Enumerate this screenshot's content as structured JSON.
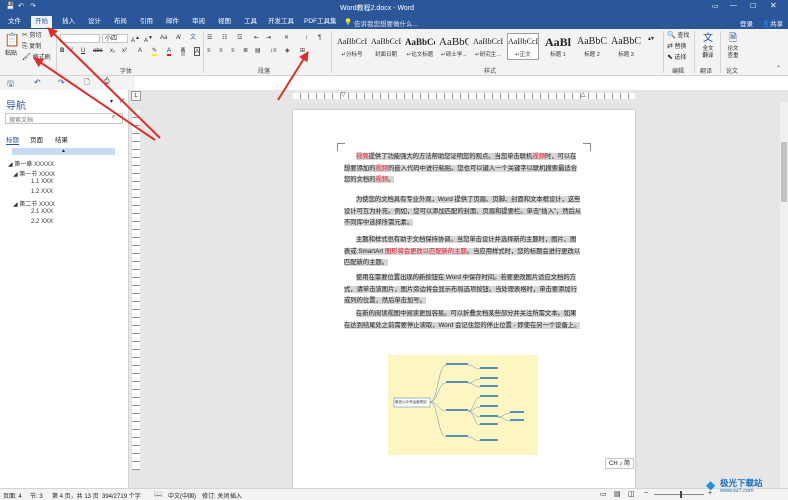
{
  "window": {
    "title": "Word教程2.docx - Word",
    "login": "登录",
    "share": "共享"
  },
  "tabs": [
    "文件",
    "开始",
    "插入",
    "设计",
    "布局",
    "引用",
    "邮件",
    "审阅",
    "视图",
    "工具",
    "开发工具",
    "PDF工具集"
  ],
  "tell_me": "告诉我您想要做什么...",
  "clipboard": {
    "paste": "粘贴",
    "cut": "剪切",
    "copy": "复制",
    "format_painter": "格式刷"
  },
  "font": {
    "size": "小四",
    "label": "字体"
  },
  "paragraph_label": "段落",
  "styles": {
    "label": "样式",
    "items": [
      {
        "sample": "AaBbCcDd",
        "name": "↵分标号"
      },
      {
        "sample": "AaBbCcDd",
        "name": "封面日期"
      },
      {
        "sample": "AaBbCcDd",
        "name": "↵论文标题"
      },
      {
        "sample": "AaBbCcDd",
        "name": "↵硕士学..."
      },
      {
        "sample": "AaBbCcDd",
        "name": "↵研究生..."
      },
      {
        "sample": "AaBbCcDd",
        "name": "↵正文"
      },
      {
        "sample": "AaBl",
        "name": "标题 1"
      },
      {
        "sample": "AaBbC",
        "name": "标题 2"
      },
      {
        "sample": "AaBbC",
        "name": "标题 3"
      }
    ]
  },
  "editing": {
    "find": "查找",
    "replace": "替换",
    "select": "选择",
    "label": "编辑"
  },
  "translate": {
    "full": "全文翻译",
    "label": "翻译"
  },
  "paper": {
    "check": "论文查重",
    "label": "论文"
  },
  "nav": {
    "title": "导航",
    "search_placeholder": "搜索文档",
    "tabs": [
      "标题",
      "页面",
      "结果"
    ],
    "tree": [
      {
        "label": "第一章 XXXXX",
        "level": 0
      },
      {
        "label": "第一节 XXXX",
        "level": 1
      },
      {
        "label": "1.1 XXX",
        "level": 2
      },
      {
        "label": "1.2 XXX",
        "level": 2
      },
      {
        "label": "第二节 XXXX",
        "level": 1
      },
      {
        "label": "2.1 XXX",
        "level": 2
      },
      {
        "label": "2.2 XXX",
        "level": 2
      }
    ]
  },
  "doc": {
    "p1": [
      "视频",
      "提供了功能强大的方法帮助您证明您的观点。当您单击联机",
      "视频",
      "时，可以在想要添加的",
      "视频",
      "的嵌入代码中进行粘贴。您也可以键入一个关键字以联机搜索最适合您的文档的",
      "视频",
      "。"
    ],
    "p2": "为使您的文档具有专业外观，Word 提供了页眉、页脚、封面和文本框设计，这些设计可互为补充。例如，您可以添加匹配的封面、页眉和提要栏。单击“插入”，然后从不同库中选择所需元素。",
    "p3": [
      "主题和样式也有助于文档保持协调。当您单击设计并选择新的主题时，图片、图表或 SmartArt ",
      "图形将会更改以匹配新的主题",
      "。当应用样式时，您的标题会进行更改以匹配新的主题。"
    ],
    "p4": "使用在需要位置出现的新按钮在 Word 中保存时间。若要更改图片适应文档的方式，请单击该图片，图片旁边将会显示布局选项按钮。当处理表格时，单击要添加行或列的位置，然后单击加号。",
    "p5": "在新的阅读视图中阅读更加容易。可以折叠文档某些部分并关注所需文本。如果在达到结尾处之前需要停止读取，Word 会记住您的停止位置 - 即使在另一个设备上。",
    "mindmap_root": "微信公众号运营规划"
  },
  "ime": "CH ♪ 简",
  "status": {
    "page": "页面: 4",
    "section": "节: 3",
    "pages": "第 4 页，共 13 页",
    "words": "394/2719 个字",
    "lang": "中文(中国)",
    "track": "修订: 关闭",
    "mode": "插入"
  },
  "watermark": {
    "text": "极光下载站",
    "url": "www.xz7.com"
  }
}
